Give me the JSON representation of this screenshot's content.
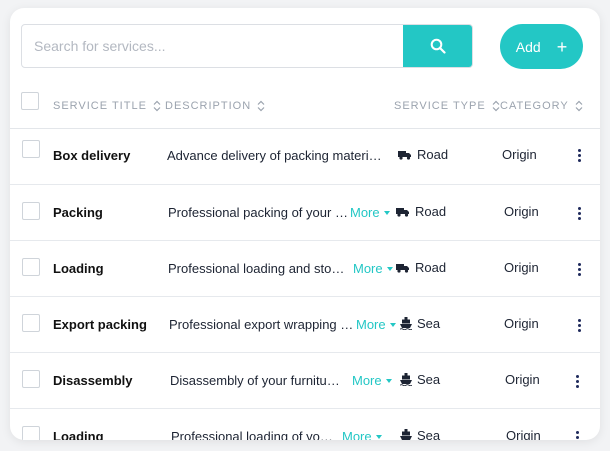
{
  "search": {
    "placeholder": "Search for services..."
  },
  "add_button": {
    "label": "Add",
    "plus": "+"
  },
  "header": {
    "service_title": "SERVICE TITLE",
    "description": "DESCRIPTION",
    "service_type": "SERVICE TYPE",
    "category": "CATEGORY"
  },
  "rows": [
    {
      "title": "Box delivery",
      "description": "Advance delivery of packing materials",
      "more": "",
      "type": "Road",
      "type_icon": "truck-icon",
      "category": "Origin"
    },
    {
      "title": "Packing",
      "description": "Professional packing of your h...",
      "more": "More",
      "type": "Road",
      "type_icon": "truck-icon",
      "category": "Origin"
    },
    {
      "title": "Loading",
      "description": "Professional loading and stowi...",
      "more": "More",
      "type": "Road",
      "type_icon": "truck-icon",
      "category": "Origin"
    },
    {
      "title": "Export packing",
      "description": "Professional export wrapping o ...",
      "more": "More",
      "type": "Sea",
      "type_icon": "ship-icon",
      "category": "Origin"
    },
    {
      "title": "Disassembly",
      "description": "Disassembly of your furniture...",
      "more": "More",
      "type": "Sea",
      "type_icon": "ship-icon",
      "category": "Origin"
    },
    {
      "title": "Loading",
      "description": "Professional loading of your ...",
      "more": "More",
      "type": "Sea",
      "type_icon": "ship-icon",
      "category": "Origin"
    }
  ],
  "colors": {
    "accent": "#23c7c5",
    "kebab": "#1f2a5c"
  }
}
